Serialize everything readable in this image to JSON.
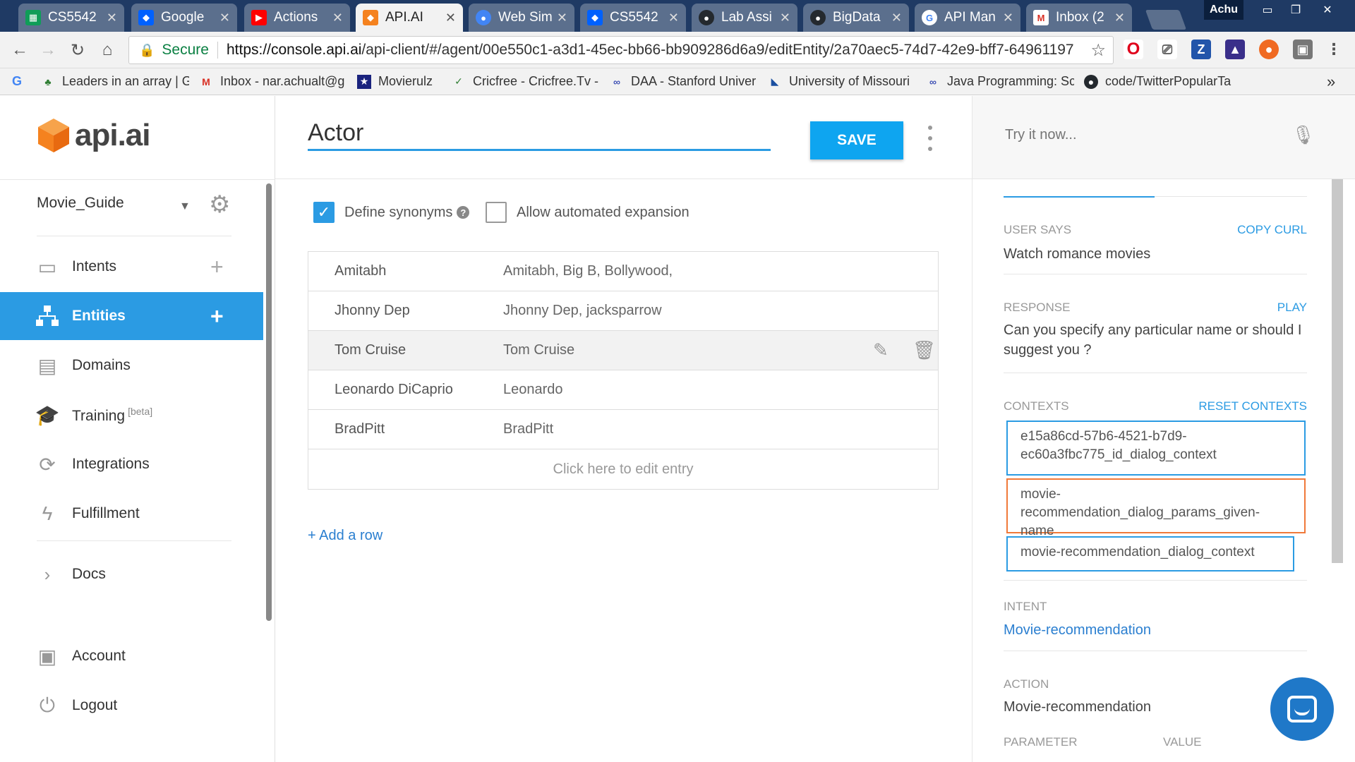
{
  "browser": {
    "tabs": [
      {
        "label": "CS5542",
        "icon": "sheets-icon",
        "color": "#0f9d58"
      },
      {
        "label": "Google",
        "icon": "dropbox-icon",
        "color": "#0061fe"
      },
      {
        "label": "Actions",
        "icon": "youtube-icon",
        "color": "#ff0000"
      },
      {
        "label": "API.AI",
        "icon": "apiai-icon",
        "color": "#f5821f"
      },
      {
        "label": "Web Sim",
        "icon": "chrome-icon",
        "color": "#4285f4"
      },
      {
        "label": "CS5542",
        "icon": "dropbox-icon",
        "color": "#0061fe"
      },
      {
        "label": "Lab Assi",
        "icon": "github-icon",
        "color": "#24292e"
      },
      {
        "label": "BigData",
        "icon": "github-icon",
        "color": "#24292e"
      },
      {
        "label": "API Man",
        "icon": "google-icon",
        "color": "#4285f4"
      },
      {
        "label": "Inbox (2",
        "icon": "gmail-icon",
        "color": "#d93025"
      }
    ],
    "profile": "Achu",
    "secure_label": "Secure",
    "url_host": "https://console.api.ai",
    "url_path": "/api-client/#/agent/00e550c1-a3d1-45ec-bb66-bb909286d6a9/editEntity/2a70aec5-74d7-42e9-bff7-64961197",
    "bookmarks": [
      {
        "label": "Leaders in an array | G",
        "icon": "leaf-icon",
        "color": "#2e7d32"
      },
      {
        "label": "Inbox - nar.achualt@g",
        "icon": "gmail-icon",
        "color": "#d93025"
      },
      {
        "label": "Movierulz",
        "icon": "movie-icon",
        "color": "#1a237e"
      },
      {
        "label": "Cricfree - Cricfree.Tv -",
        "icon": "check-icon",
        "color": "#2e7d32"
      },
      {
        "label": "DAA - Stanford Univer",
        "icon": "infinity-icon",
        "color": "#3f51b5"
      },
      {
        "label": "University of Missouri",
        "icon": "flag-icon",
        "color": "#1a4fa0"
      },
      {
        "label": "Java Programming: Sc",
        "icon": "infinity-icon",
        "color": "#3f51b5"
      },
      {
        "label": "code/TwitterPopularTa",
        "icon": "github-icon",
        "color": "#24292e"
      }
    ],
    "bookmarks_more": "»"
  },
  "sidebar": {
    "logo": "api.ai",
    "agent": "Movie_Guide",
    "items": [
      {
        "label": "Intents",
        "icon": "intents-icon",
        "plus": true
      },
      {
        "label": "Entities",
        "icon": "entities-icon",
        "plus": true
      },
      {
        "label": "Domains",
        "icon": "domains-icon"
      },
      {
        "label": "Training",
        "icon": "training-icon",
        "sup": "[beta]"
      },
      {
        "label": "Integrations",
        "icon": "integrations-icon"
      },
      {
        "label": "Fulfillment",
        "icon": "fulfillment-icon"
      },
      {
        "label": "Docs",
        "icon": "chevron-right-icon"
      },
      {
        "label": "Account",
        "icon": "account-icon"
      },
      {
        "label": "Logout",
        "icon": "power-icon"
      }
    ]
  },
  "entity": {
    "name": "Actor",
    "save_label": "SAVE",
    "define_synonyms": "Define synonyms",
    "allow_expansion": "Allow automated expansion",
    "rows": [
      {
        "value": "Amitabh",
        "synonyms": "Amitabh, Big B, Bollywood,"
      },
      {
        "value": "Jhonny Dep",
        "synonyms": "Jhonny Dep, jacksparrow"
      },
      {
        "value": "Tom Cruise",
        "synonyms": "Tom Cruise"
      },
      {
        "value": "Leonardo DiCaprio",
        "synonyms": "Leonardo"
      },
      {
        "value": "BradPitt",
        "synonyms": "BradPitt"
      }
    ],
    "edit_placeholder": "Click here to edit entry",
    "add_row": "+ Add a row"
  },
  "console": {
    "try_placeholder": "Try it now...",
    "user_says_label": "USER SAYS",
    "copy_curl": "COPY CURL",
    "user_says": "Watch romance movies",
    "response_label": "RESPONSE",
    "play": "PLAY",
    "response": "Can you specify any particular name or should I suggest you ?",
    "contexts_label": "CONTEXTS",
    "reset_contexts": "RESET CONTEXTS",
    "contexts": [
      "e15a86cd-57b6-4521-b7d9-ec60a3fbc775_id_dialog_context",
      "movie-recommendation_dialog_params_given-name",
      "movie-recommendation_dialog_context"
    ],
    "intent_label": "INTENT",
    "intent": "Movie-recommendation",
    "action_label": "ACTION",
    "action": "Movie-recommendation",
    "parameter_label": "PARAMETER",
    "value_label": "VALUE"
  }
}
